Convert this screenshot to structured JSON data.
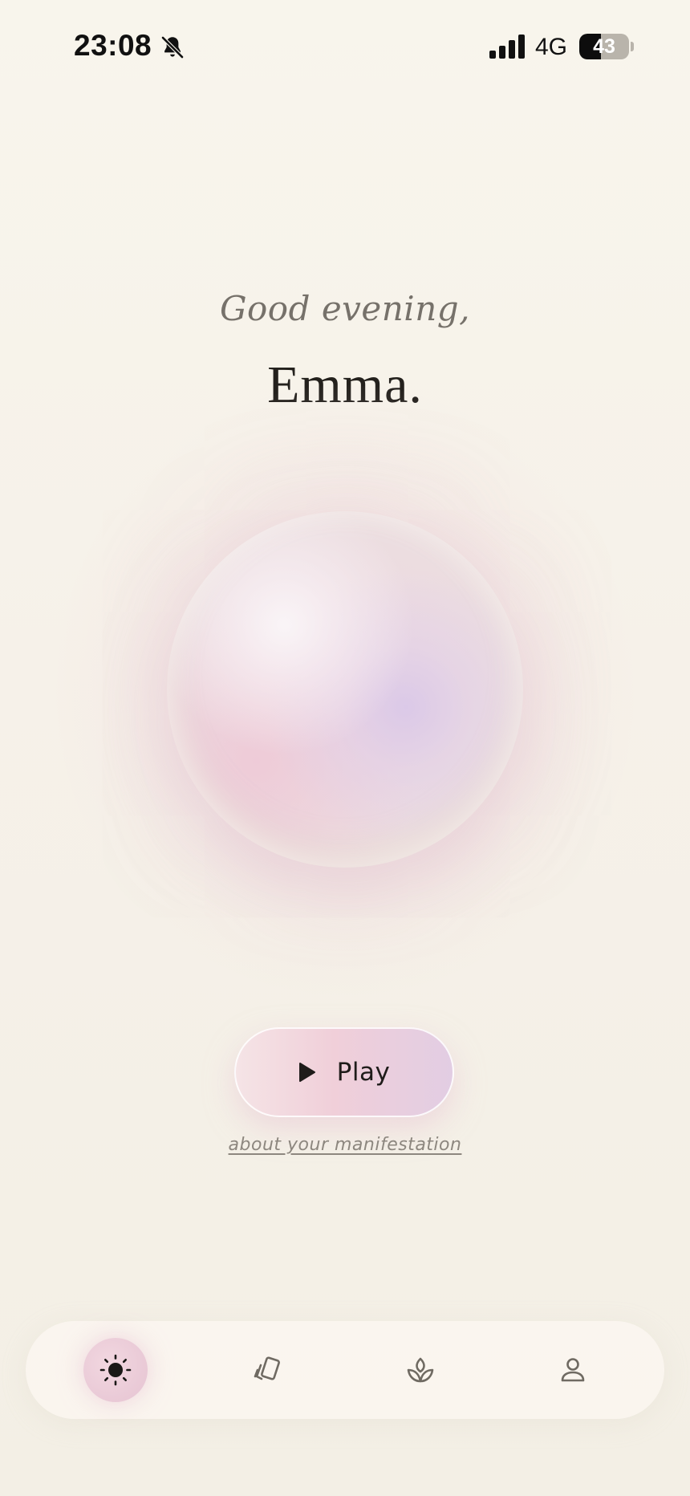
{
  "status_bar": {
    "time": "23:08",
    "network": "4G",
    "battery_level": 43,
    "battery_text": "43",
    "icons": [
      "bell-off-icon",
      "signal-icon",
      "battery-icon"
    ]
  },
  "greeting": {
    "salutation": "Good evening,",
    "name": "Emma."
  },
  "orb": {
    "icon": "orb",
    "colors": [
      "#eed9e2",
      "#dac8e8",
      "#eec8d6"
    ]
  },
  "actions": {
    "play_label": "Play",
    "play_icon": "play-icon",
    "link_text": "about your manifestation"
  },
  "bottom_nav": {
    "items": [
      {
        "id": "home",
        "icon": "sun-icon",
        "active": true
      },
      {
        "id": "cards",
        "icon": "cards-icon",
        "active": false
      },
      {
        "id": "grow",
        "icon": "sprout-icon",
        "active": false
      },
      {
        "id": "profile",
        "icon": "person-icon",
        "active": false
      }
    ],
    "active_color": "#e9c9d6",
    "icon_color": "#6f6a62"
  }
}
